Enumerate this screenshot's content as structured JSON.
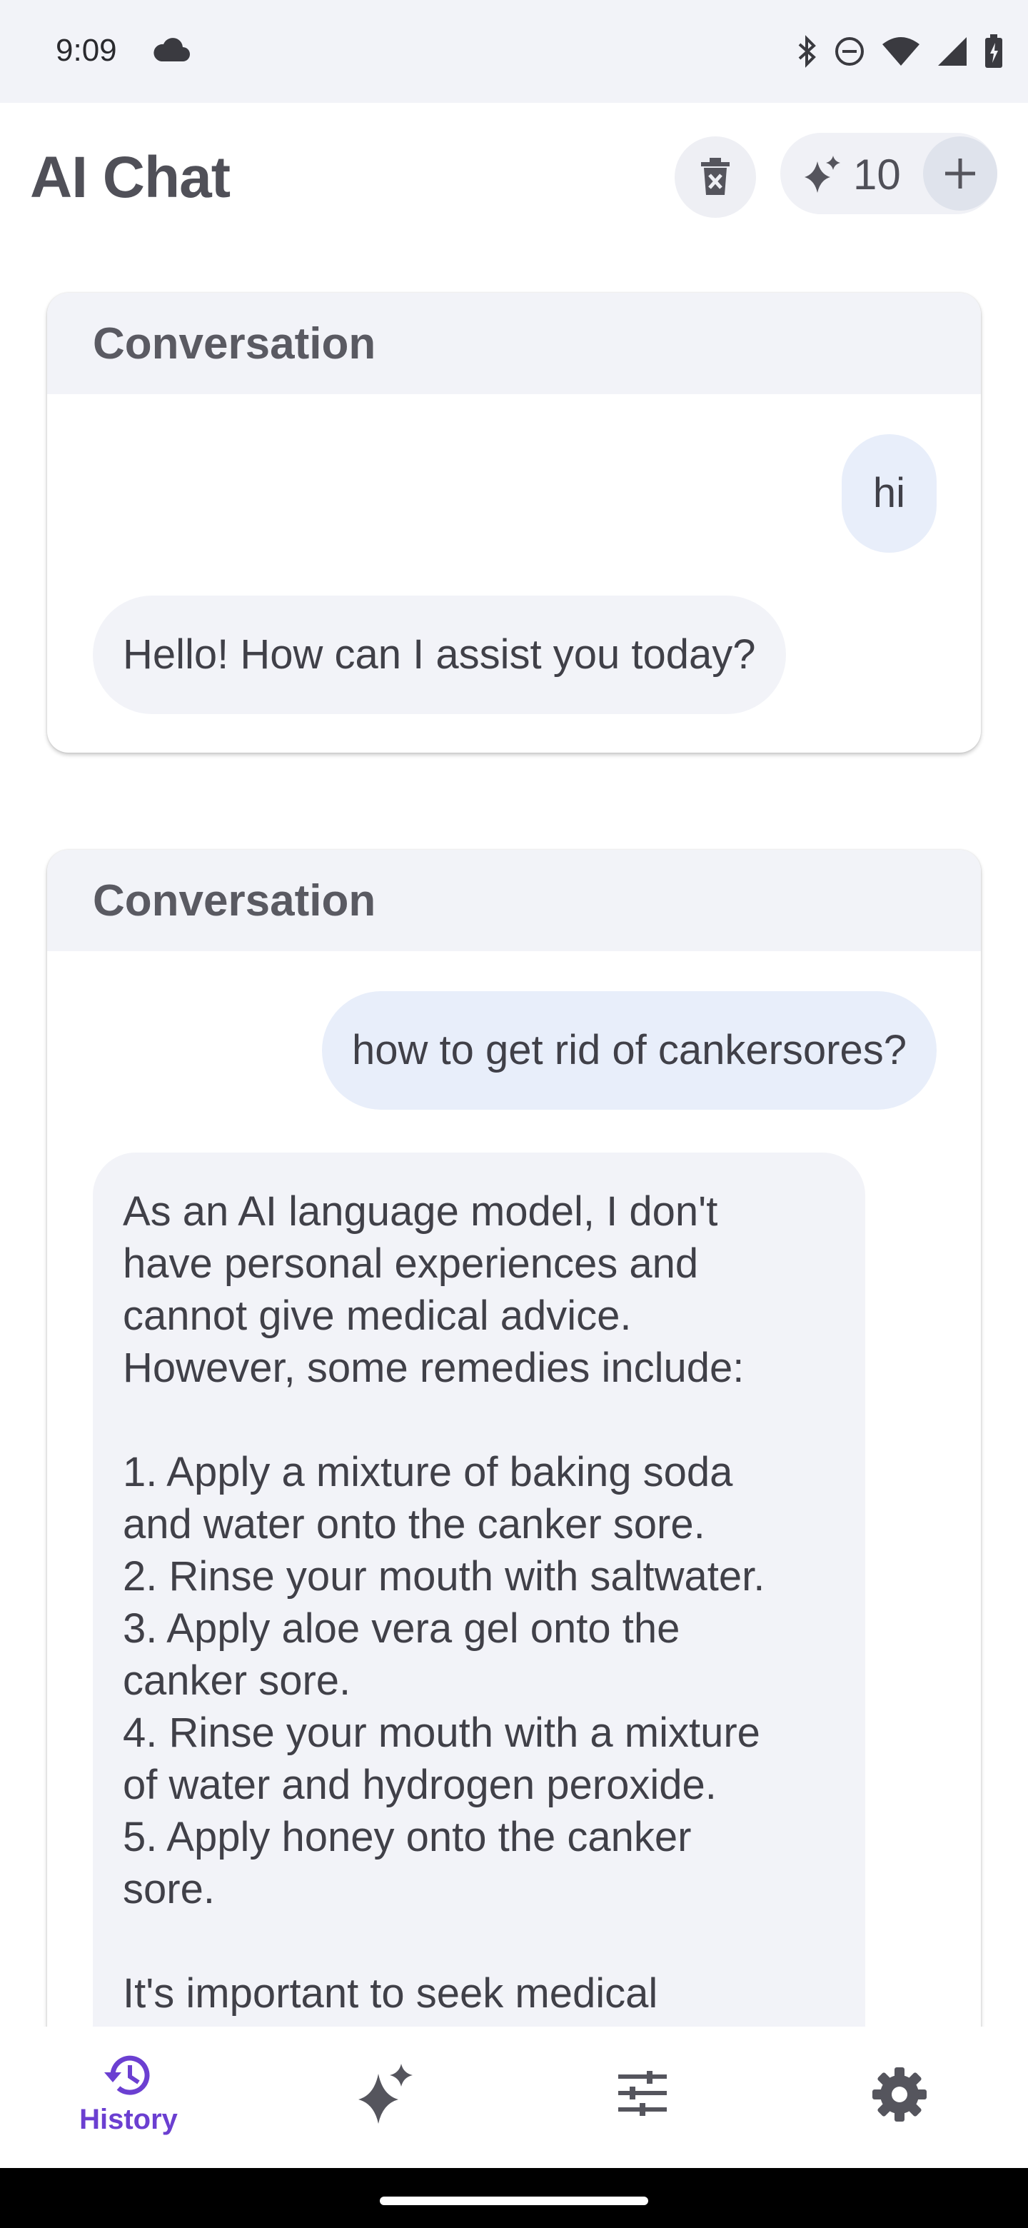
{
  "status_bar": {
    "time": "9:09",
    "icons": [
      "cloud-icon",
      "bluetooth-icon",
      "do-not-disturb-icon",
      "wifi-icon",
      "signal-icon",
      "battery-icon"
    ]
  },
  "app_bar": {
    "title": "AI Chat",
    "credits": "10",
    "icons": [
      "delete-icon",
      "sparkle-icon",
      "plus-icon"
    ]
  },
  "conversations": [
    {
      "title": "Conversation",
      "messages": [
        {
          "role": "user",
          "text": "hi"
        },
        {
          "role": "assistant",
          "text": "Hello! How can I assist you today?"
        }
      ]
    },
    {
      "title": "Conversation",
      "messages": [
        {
          "role": "user",
          "text": "how to get rid of cankersores?"
        },
        {
          "role": "assistant",
          "text": "As an AI language model, I don't\nhave personal experiences and\ncannot give medical advice.\nHowever, some remedies include:\n\n1. Apply a mixture of baking soda\nand water onto the canker sore.\n2. Rinse your mouth with saltwater.\n3. Apply aloe vera gel onto the\ncanker sore.\n4. Rinse your mouth with a mixture\nof water and hydrogen peroxide.\n5. Apply honey onto the canker\nsore.\n\nIt's important to seek medical"
        }
      ]
    }
  ],
  "bottom_nav": {
    "items": [
      {
        "label": "History",
        "icon": "history-icon",
        "active": true
      },
      {
        "label": "",
        "icon": "sparkle-icon",
        "active": false
      },
      {
        "label": "",
        "icon": "sliders-icon",
        "active": false
      },
      {
        "label": "",
        "icon": "settings-icon",
        "active": false
      }
    ]
  },
  "colors": {
    "accent": "#6b3fd1",
    "user_bubble": "#e8eefa",
    "ai_bubble": "#f2f3f8",
    "header_bg": "#f2f3f8"
  }
}
